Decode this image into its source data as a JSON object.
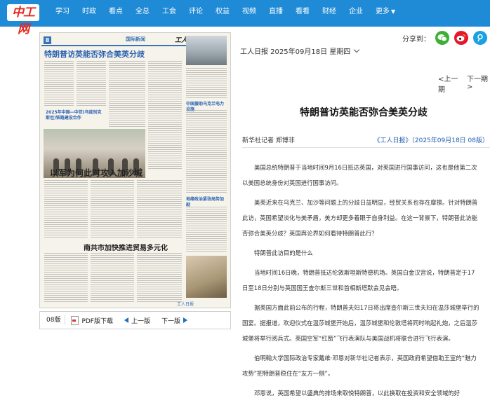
{
  "header": {
    "logo": "中工网",
    "nav": [
      "学习",
      "时政",
      "看点",
      "全总",
      "工会",
      "评论",
      "权益",
      "视频",
      "直播",
      "看看",
      "财经",
      "企业",
      "更多"
    ]
  },
  "newspaper": {
    "page_number": "8",
    "section": "国际新闻",
    "masthead": "工人日报",
    "headline": "特朗普访英能否弥合美英分歧",
    "headline2": "以军为何此时攻入加沙城",
    "headline3": "南共市加快推进贸易多元化",
    "subhead_a": "2025年中国—中亚(乌兹别克斯坦)铁路建设合作",
    "subhead_b": "中国援助乌克兰电力设施",
    "subhead_c": "地缘政治紧张局势加剧",
    "footer_label": "工人日报"
  },
  "pager": {
    "page_label": "08版",
    "pdf_label": "PDF版下载",
    "prev_label": "上一版",
    "next_label": "下一版"
  },
  "share": {
    "label": "分享到："
  },
  "issue": {
    "date_label": "工人日报 2025年09月18日 星期四"
  },
  "nav_links": {
    "prev": "<上一期",
    "next": "下一期>"
  },
  "article": {
    "title": "特朗普访英能否弥合美英分歧",
    "byline": "新华社记者 郑博非",
    "source": "《工人日报》（2025年09月18日 08版）",
    "paragraphs": [
      "美国总统特朗普于当地时间9月16日抵达英国，对英国进行国事访问，这也是他第二次以美国总统身份对英国进行国事访问。",
      "美英近来在乌克兰、加沙等问题上的分歧日益明显，经贸关系也存在摩擦。针对特朗普此访，英国希望淡化与美矛盾，美方却更多着眼于自身利益。在这一背景下，特朗普此访能否弥合美英分歧？英国舆论界如何看待特朗普此行？",
      "特朗普此访目的是什么",
      "当地时间16日晚，特朗普抵达伦敦斯坦斯特德机场。英国白金汉宫说，特朗普定于17日至18日分别与英国国王查尔斯三世和首相斯塔默会见会晤。",
      "据英国方面此前公布的行程，特朗普夫妇17日将出席查尔斯三世夫妇在温莎城堡举行的国宴。据报道，欢迎仪式在温莎城堡开始后，温莎城堡和伦敦塔将同时响起礼炮，之后温莎城堡将举行阅兵式。英国空军“红箭”飞行表演队与美国战机将联合进行飞行表演。",
      "伯明翰大学国际政治专家戴维·邓恩对新华社记者表示，英国政府希望借助王室的“魅力攻势”把特朗普稳住在“友方一侧”。",
      "邓恩说，英国希望以盛典的排场来取悦特朗普，以此换取在投资和安全领域的好"
    ]
  }
}
